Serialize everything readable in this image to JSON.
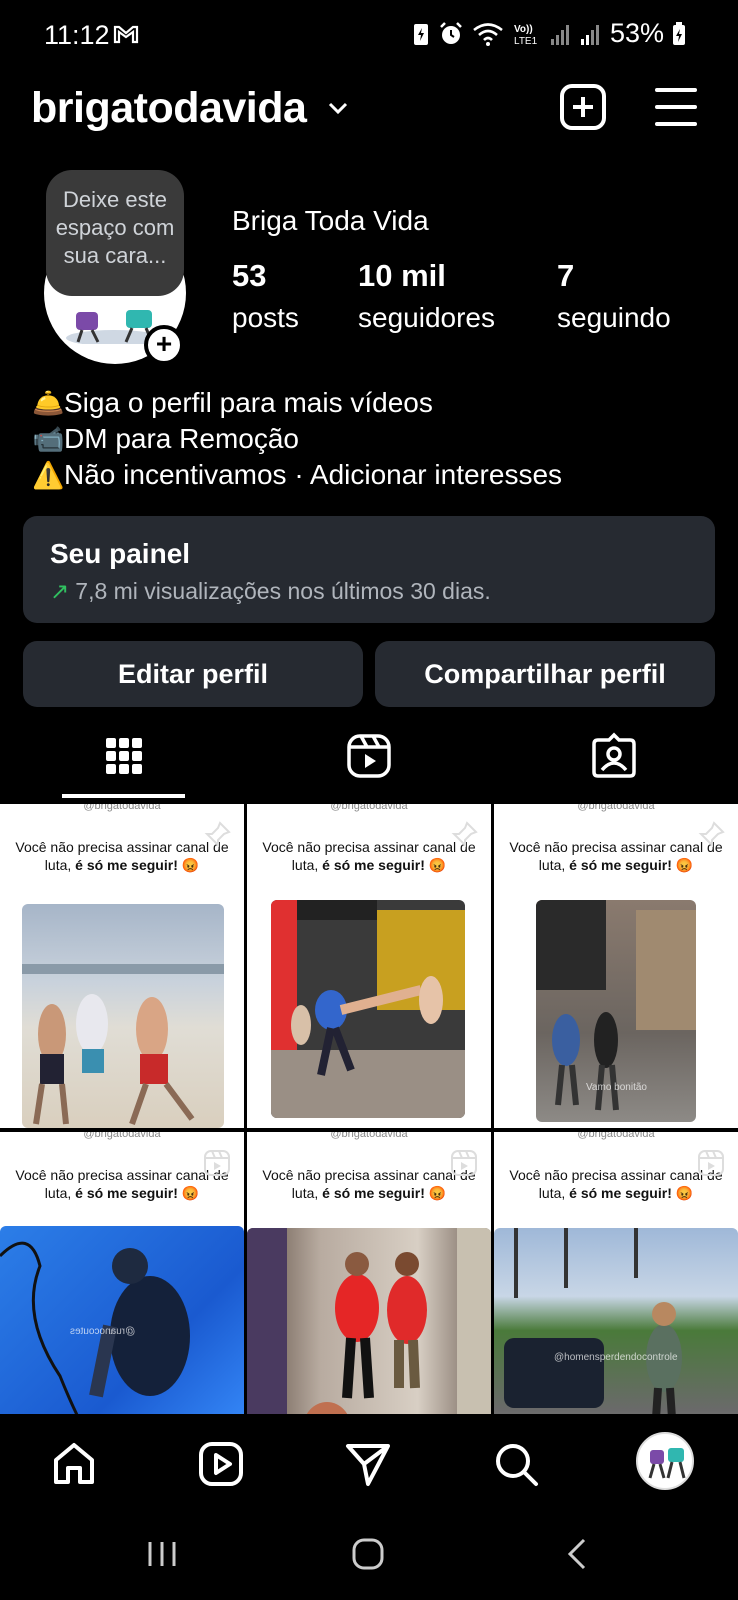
{
  "status_bar": {
    "time": "11:12",
    "battery": "53%",
    "icons": [
      "gmail-icon",
      "battery-saver-icon",
      "alarm-icon",
      "wifi-icon",
      "volte-icon",
      "signal-icon",
      "signal-icon",
      "battery-icon"
    ],
    "volte_text": "Vo)) LTE1"
  },
  "header": {
    "username": "brigatodavida"
  },
  "profile": {
    "avatar_prompt": "Deixe este espaço com sua cara...",
    "full_name": "Briga Toda Vida",
    "stats": [
      {
        "value": "53",
        "label": "posts"
      },
      {
        "value": "10 mil",
        "label": "seguidores"
      },
      {
        "value": "7",
        "label": "seguindo"
      }
    ],
    "bio": [
      {
        "emoji": "🛎️",
        "text": "Siga o perfil para mais vídeos"
      },
      {
        "emoji": "📹",
        "text": "DM para Remoção"
      },
      {
        "emoji": "⚠️",
        "text": "Não incentivamos · Adicionar interesses"
      }
    ]
  },
  "dashboard": {
    "title": "Seu painel",
    "arrow": "↗",
    "subtitle": "7,8 mi visualizações nos últimos 30 dias."
  },
  "buttons": {
    "edit": "Editar perfil",
    "share": "Compartilhar perfil"
  },
  "posts": [
    {
      "handle": "@brigatodavida",
      "caption_a": "Você não precisa assinar canal de luta, ",
      "caption_b": "é só me seguir!",
      "emoji": "😡",
      "overlay": ""
    },
    {
      "handle": "@brigatodavida",
      "caption_a": "Você não precisa assinar canal de luta, ",
      "caption_b": "é só me seguir!",
      "emoji": "😡",
      "overlay": ""
    },
    {
      "handle": "@brigatodavida",
      "caption_a": "Você não precisa assinar canal de luta, ",
      "caption_b": "é só me seguir!",
      "emoji": "😡",
      "overlay": "Vamo bonitão"
    },
    {
      "handle": "@brigatodavida",
      "caption_a": "Você não precisa assinar canal de luta, ",
      "caption_b": "é só me seguir!",
      "emoji": "😡",
      "overlay": "@ruanocoutes"
    },
    {
      "handle": "@brigatodavida",
      "caption_a": "Você não precisa assinar canal de luta, ",
      "caption_b": "é só me seguir!",
      "emoji": "😡",
      "overlay": ""
    },
    {
      "handle": "@brigatodavida",
      "caption_a": "Você não precisa assinar canal de luta, ",
      "caption_b": "é só me seguir!",
      "emoji": "😡",
      "overlay": "@homensperdendocontrole"
    }
  ],
  "colors": {
    "background": "#000000",
    "card": "#262a31",
    "muted_text": "#b0b5bc",
    "trend_green": "#30c060"
  }
}
